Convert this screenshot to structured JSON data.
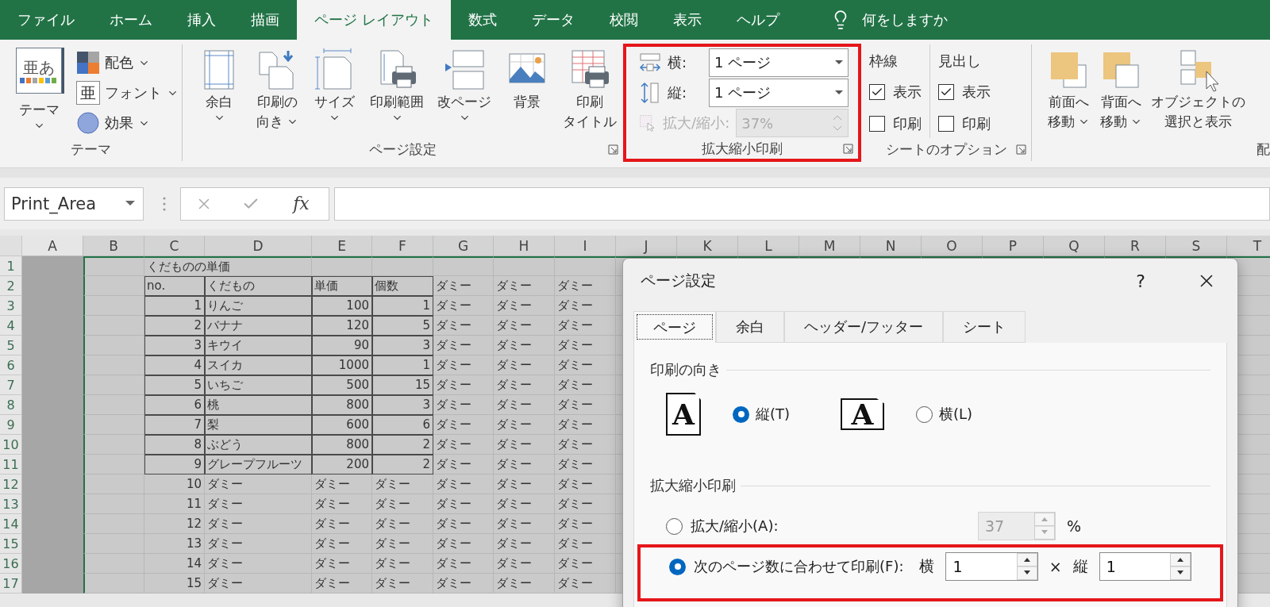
{
  "ribbon_tabs": [
    {
      "label": "ファイル",
      "selected": false
    },
    {
      "label": "ホーム",
      "selected": false
    },
    {
      "label": "挿入",
      "selected": false
    },
    {
      "label": "描画",
      "selected": false
    },
    {
      "label": "ページ レイアウト",
      "selected": true
    },
    {
      "label": "数式",
      "selected": false
    },
    {
      "label": "データ",
      "selected": false
    },
    {
      "label": "校閲",
      "selected": false
    },
    {
      "label": "表示",
      "selected": false
    },
    {
      "label": "ヘルプ",
      "selected": false
    }
  ],
  "tell_me": {
    "label": "何をしますか"
  },
  "theme_group": {
    "label": "テーマ",
    "themes_button": "テーマ",
    "themes_icon_text": "亜あ",
    "items": [
      {
        "kind": "colors",
        "label": "配色"
      },
      {
        "kind": "fonts",
        "label": "フォント",
        "icon_text": "亜"
      },
      {
        "kind": "effects",
        "label": "効果"
      }
    ]
  },
  "page_setup_group": {
    "label": "ページ設定",
    "buttons": [
      {
        "kind": "margins",
        "lines": [
          "余白"
        ],
        "dropdown": true
      },
      {
        "kind": "orientation",
        "lines": [
          "印刷の",
          "向き"
        ],
        "dropdown": true
      },
      {
        "kind": "size",
        "lines": [
          "サイズ"
        ],
        "dropdown": true
      },
      {
        "kind": "print_area",
        "lines": [
          "印刷範囲"
        ],
        "dropdown": true
      },
      {
        "kind": "breaks",
        "lines": [
          "改ページ"
        ],
        "dropdown": true
      },
      {
        "kind": "background",
        "lines": [
          "背景"
        ],
        "dropdown": false
      },
      {
        "kind": "print_titles",
        "lines": [
          "印刷",
          "タイトル"
        ],
        "dropdown": false
      }
    ]
  },
  "scale_group": {
    "label": "拡大縮小印刷",
    "highlighted": true,
    "rows": [
      {
        "kind": "width",
        "label": "横:",
        "value": "1 ページ",
        "disabled": false
      },
      {
        "kind": "height",
        "label": "縦:",
        "value": "1 ページ",
        "disabled": false
      },
      {
        "kind": "scale",
        "label": "拡大/縮小:",
        "value": "37%",
        "disabled": true
      }
    ]
  },
  "sheet_options_group": {
    "label": "シートのオプション",
    "columns": [
      {
        "heading": "枠線",
        "options": [
          {
            "label": "表示",
            "checked": true
          },
          {
            "label": "印刷",
            "checked": false
          }
        ]
      },
      {
        "heading": "見出し",
        "options": [
          {
            "label": "表示",
            "checked": true
          },
          {
            "label": "印刷",
            "checked": false
          }
        ]
      }
    ]
  },
  "arrange_group": {
    "label": "配",
    "buttons": [
      {
        "kind": "bring_forward",
        "lines": [
          "前面へ",
          "移動"
        ],
        "dropdown": true
      },
      {
        "kind": "send_backward",
        "lines": [
          "背面へ",
          "移動"
        ],
        "dropdown": true
      },
      {
        "kind": "selection_pane",
        "lines": [
          "オブジェクトの",
          "選択と表示"
        ],
        "dropdown": false
      }
    ]
  },
  "formula_bar": {
    "name_box": "Print_Area",
    "function_label": "fx"
  },
  "sheet": {
    "columns": [
      "A",
      "B",
      "C",
      "D",
      "E",
      "F",
      "G",
      "H",
      "I",
      "J",
      "K",
      "L",
      "M",
      "N",
      "O",
      "P",
      "Q",
      "R",
      "S",
      "T"
    ],
    "rows": [
      {
        "number": "1",
        "table_row": false,
        "cells": [
          "",
          "",
          {
            "kind": "text",
            "text": "くだものの単価"
          },
          "",
          "",
          "",
          "",
          "",
          ""
        ]
      },
      {
        "number": "2",
        "table_row": true,
        "cells": [
          "",
          "",
          {
            "kind": "text",
            "text": "no."
          },
          {
            "kind": "text",
            "text": "くだもの"
          },
          {
            "kind": "text",
            "text": "単価"
          },
          {
            "kind": "text",
            "text": "個数"
          },
          {
            "kind": "text",
            "text": "ダミー"
          },
          {
            "kind": "text",
            "text": "ダミー"
          },
          {
            "kind": "text",
            "text": "ダミー"
          }
        ]
      },
      {
        "number": "3",
        "table_row": true,
        "cells": [
          "",
          "",
          {
            "kind": "number",
            "text": "1"
          },
          {
            "kind": "text",
            "text": "りんご"
          },
          {
            "kind": "number",
            "text": "100"
          },
          {
            "kind": "number",
            "text": "1"
          },
          {
            "kind": "text",
            "text": "ダミー"
          },
          {
            "kind": "text",
            "text": "ダミー"
          },
          {
            "kind": "text",
            "text": "ダミー"
          }
        ]
      },
      {
        "number": "4",
        "table_row": true,
        "cells": [
          "",
          "",
          {
            "kind": "number",
            "text": "2"
          },
          {
            "kind": "text",
            "text": "バナナ"
          },
          {
            "kind": "number",
            "text": "120"
          },
          {
            "kind": "number",
            "text": "5"
          },
          {
            "kind": "text",
            "text": "ダミー"
          },
          {
            "kind": "text",
            "text": "ダミー"
          },
          {
            "kind": "text",
            "text": "ダミー"
          }
        ]
      },
      {
        "number": "5",
        "table_row": true,
        "cells": [
          "",
          "",
          {
            "kind": "number",
            "text": "3"
          },
          {
            "kind": "text",
            "text": "キウイ"
          },
          {
            "kind": "number",
            "text": "90"
          },
          {
            "kind": "number",
            "text": "3"
          },
          {
            "kind": "text",
            "text": "ダミー"
          },
          {
            "kind": "text",
            "text": "ダミー"
          },
          {
            "kind": "text",
            "text": "ダミー"
          }
        ]
      },
      {
        "number": "6",
        "table_row": true,
        "cells": [
          "",
          "",
          {
            "kind": "number",
            "text": "4"
          },
          {
            "kind": "text",
            "text": "スイカ"
          },
          {
            "kind": "number",
            "text": "1000"
          },
          {
            "kind": "number",
            "text": "1"
          },
          {
            "kind": "text",
            "text": "ダミー"
          },
          {
            "kind": "text",
            "text": "ダミー"
          },
          {
            "kind": "text",
            "text": "ダミー"
          }
        ]
      },
      {
        "number": "7",
        "table_row": true,
        "cells": [
          "",
          "",
          {
            "kind": "number",
            "text": "5"
          },
          {
            "kind": "text",
            "text": "いちご"
          },
          {
            "kind": "number",
            "text": "500"
          },
          {
            "kind": "number",
            "text": "15"
          },
          {
            "kind": "text",
            "text": "ダミー"
          },
          {
            "kind": "text",
            "text": "ダミー"
          },
          {
            "kind": "text",
            "text": "ダミー"
          }
        ]
      },
      {
        "number": "8",
        "table_row": true,
        "cells": [
          "",
          "",
          {
            "kind": "number",
            "text": "6"
          },
          {
            "kind": "text",
            "text": "桃"
          },
          {
            "kind": "number",
            "text": "800"
          },
          {
            "kind": "number",
            "text": "3"
          },
          {
            "kind": "text",
            "text": "ダミー"
          },
          {
            "kind": "text",
            "text": "ダミー"
          },
          {
            "kind": "text",
            "text": "ダミー"
          }
        ]
      },
      {
        "number": "9",
        "table_row": true,
        "cells": [
          "",
          "",
          {
            "kind": "number",
            "text": "7"
          },
          {
            "kind": "text",
            "text": "梨"
          },
          {
            "kind": "number",
            "text": "600"
          },
          {
            "kind": "number",
            "text": "6"
          },
          {
            "kind": "text",
            "text": "ダミー"
          },
          {
            "kind": "text",
            "text": "ダミー"
          },
          {
            "kind": "text",
            "text": "ダミー"
          }
        ]
      },
      {
        "number": "10",
        "table_row": true,
        "cells": [
          "",
          "",
          {
            "kind": "number",
            "text": "8"
          },
          {
            "kind": "text",
            "text": "ぶどう"
          },
          {
            "kind": "number",
            "text": "800"
          },
          {
            "kind": "number",
            "text": "2"
          },
          {
            "kind": "text",
            "text": "ダミー"
          },
          {
            "kind": "text",
            "text": "ダミー"
          },
          {
            "kind": "text",
            "text": "ダミー"
          }
        ]
      },
      {
        "number": "11",
        "table_row": true,
        "cells": [
          "",
          "",
          {
            "kind": "number",
            "text": "9"
          },
          {
            "kind": "text",
            "text": "グレープフルーツ"
          },
          {
            "kind": "number",
            "text": "200"
          },
          {
            "kind": "number",
            "text": "2"
          },
          {
            "kind": "text",
            "text": "ダミー"
          },
          {
            "kind": "text",
            "text": "ダミー"
          },
          {
            "kind": "text",
            "text": "ダミー"
          }
        ]
      },
      {
        "number": "12",
        "table_row": false,
        "cells": [
          "",
          "",
          {
            "kind": "number",
            "text": "10"
          },
          {
            "kind": "text",
            "text": "ダミー"
          },
          {
            "kind": "text",
            "text": "ダミー"
          },
          {
            "kind": "text",
            "text": "ダミー"
          },
          {
            "kind": "text",
            "text": "ダミー"
          },
          {
            "kind": "text",
            "text": "ダミー"
          },
          {
            "kind": "text",
            "text": "ダミー"
          }
        ]
      },
      {
        "number": "13",
        "table_row": false,
        "cells": [
          "",
          "",
          {
            "kind": "number",
            "text": "11"
          },
          {
            "kind": "text",
            "text": "ダミー"
          },
          {
            "kind": "text",
            "text": "ダミー"
          },
          {
            "kind": "text",
            "text": "ダミー"
          },
          {
            "kind": "text",
            "text": "ダミー"
          },
          {
            "kind": "text",
            "text": "ダミー"
          },
          {
            "kind": "text",
            "text": "ダミー"
          }
        ]
      },
      {
        "number": "14",
        "table_row": false,
        "cells": [
          "",
          "",
          {
            "kind": "number",
            "text": "12"
          },
          {
            "kind": "text",
            "text": "ダミー"
          },
          {
            "kind": "text",
            "text": "ダミー"
          },
          {
            "kind": "text",
            "text": "ダミー"
          },
          {
            "kind": "text",
            "text": "ダミー"
          },
          {
            "kind": "text",
            "text": "ダミー"
          },
          {
            "kind": "text",
            "text": "ダミー"
          }
        ]
      },
      {
        "number": "15",
        "table_row": false,
        "cells": [
          "",
          "",
          {
            "kind": "number",
            "text": "13"
          },
          {
            "kind": "text",
            "text": "ダミー"
          },
          {
            "kind": "text",
            "text": "ダミー"
          },
          {
            "kind": "text",
            "text": "ダミー"
          },
          {
            "kind": "text",
            "text": "ダミー"
          },
          {
            "kind": "text",
            "text": "ダミー"
          },
          {
            "kind": "text",
            "text": "ダミー"
          }
        ]
      },
      {
        "number": "16",
        "table_row": false,
        "cells": [
          "",
          "",
          {
            "kind": "number",
            "text": "14"
          },
          {
            "kind": "text",
            "text": "ダミー"
          },
          {
            "kind": "text",
            "text": "ダミー"
          },
          {
            "kind": "text",
            "text": "ダミー"
          },
          {
            "kind": "text",
            "text": "ダミー"
          },
          {
            "kind": "text",
            "text": "ダミー"
          },
          {
            "kind": "text",
            "text": "ダミー"
          }
        ]
      },
      {
        "number": "17",
        "table_row": false,
        "cells": [
          "",
          "",
          {
            "kind": "number",
            "text": "15"
          },
          {
            "kind": "text",
            "text": "ダミー"
          },
          {
            "kind": "text",
            "text": "ダミー"
          },
          {
            "kind": "text",
            "text": "ダミー"
          },
          {
            "kind": "text",
            "text": "ダミー"
          },
          {
            "kind": "text",
            "text": "ダミー"
          },
          {
            "kind": "text",
            "text": "ダミー"
          }
        ]
      }
    ]
  },
  "dialog": {
    "title": "ページ設定",
    "help": "?",
    "tabs": [
      {
        "label": "ページ",
        "selected": true
      },
      {
        "label": "余白",
        "selected": false
      },
      {
        "label": "ヘッダー/フッター",
        "selected": false
      },
      {
        "label": "シート",
        "selected": false
      }
    ],
    "orientation": {
      "heading": "印刷の向き",
      "options": [
        {
          "kind": "portrait",
          "icon_text": "A",
          "label": "縦(T)",
          "selected": true
        },
        {
          "kind": "landscape",
          "icon_text": "A",
          "label": "横(L)",
          "selected": false
        }
      ]
    },
    "scaling": {
      "heading": "拡大縮小印刷",
      "adjust": {
        "label": "拡大/縮小(A):",
        "selected": false,
        "value": "37",
        "unit": "%",
        "disabled": true
      },
      "fit": {
        "label": "次のページ数に合わせて印刷(F):",
        "selected": true,
        "highlighted": true,
        "wide_label": "横",
        "wide_value": "1",
        "times": "×",
        "tall_label": "縦",
        "tall_value": "1"
      }
    }
  }
}
